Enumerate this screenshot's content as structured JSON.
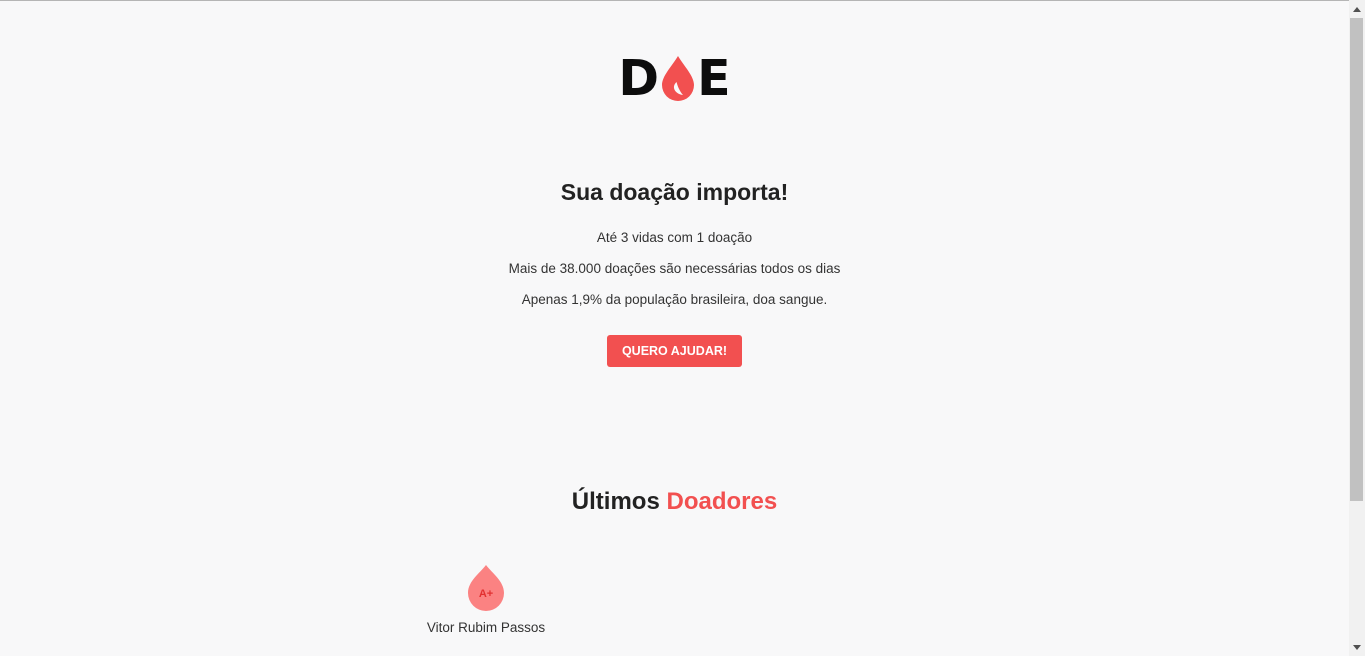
{
  "logo": {
    "letter_left": "D",
    "letter_right": "E",
    "drop_icon": "blood-drop-icon",
    "accent_color": "#f25050"
  },
  "hero": {
    "title": "Sua doação importa!",
    "lines": [
      "Até 3 vidas com 1 doação",
      "Mais de 38.000 doações são necessárias todos os dias",
      "Apenas 1,9% da população brasileira, doa sangue."
    ],
    "cta_label": "QUERO AJUDAR!"
  },
  "donors": {
    "title_main": "Últimos",
    "title_accent": "Doadores",
    "items": [
      {
        "blood_type": "A+",
        "name": "Vitor Rubim Passos"
      }
    ]
  }
}
